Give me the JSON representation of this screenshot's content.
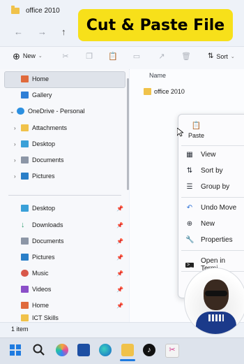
{
  "window": {
    "tab_title": "office 2010"
  },
  "overlay": {
    "badge_text": "Cut & Paste File"
  },
  "toolbar": {
    "new_label": "New",
    "sort_label": "Sort"
  },
  "sidebar": {
    "items": [
      {
        "label": "Home",
        "icon": "home-icon"
      },
      {
        "label": "Gallery",
        "icon": "gallery-icon"
      },
      {
        "label": "OneDrive - Personal",
        "icon": "cloud-icon"
      },
      {
        "label": "Attachments",
        "icon": "folder-icon"
      },
      {
        "label": "Desktop",
        "icon": "desktop-icon"
      },
      {
        "label": "Documents",
        "icon": "documents-icon"
      },
      {
        "label": "Pictures",
        "icon": "pictures-icon"
      }
    ],
    "quick_access": [
      {
        "label": "Desktop",
        "icon": "desktop-icon"
      },
      {
        "label": "Downloads",
        "icon": "download-icon"
      },
      {
        "label": "Documents",
        "icon": "documents-icon"
      },
      {
        "label": "Pictures",
        "icon": "pictures-icon"
      },
      {
        "label": "Music",
        "icon": "music-icon"
      },
      {
        "label": "Videos",
        "icon": "videos-icon"
      },
      {
        "label": "Home",
        "icon": "home-icon"
      },
      {
        "label": "ICT Skills",
        "icon": "folder-icon"
      }
    ]
  },
  "content": {
    "column_header": "Name",
    "files": [
      {
        "name": "office 2010"
      }
    ]
  },
  "context_menu": {
    "paste_label": "Paste",
    "items": [
      {
        "label": "View",
        "icon": "view-icon"
      },
      {
        "label": "Sort by",
        "icon": "sort-icon"
      },
      {
        "label": "Group by",
        "icon": "group-icon"
      },
      {
        "label": "Undo Move",
        "icon": "undo-icon"
      },
      {
        "label": "New",
        "icon": "new-icon"
      },
      {
        "label": "Properties",
        "icon": "properties-icon"
      },
      {
        "label": "Open in Termi",
        "icon": "terminal-icon"
      }
    ]
  },
  "status": {
    "item_count": "1 item"
  },
  "colors": {
    "accent": "#f7e01a",
    "folder": "#f0c24a"
  }
}
